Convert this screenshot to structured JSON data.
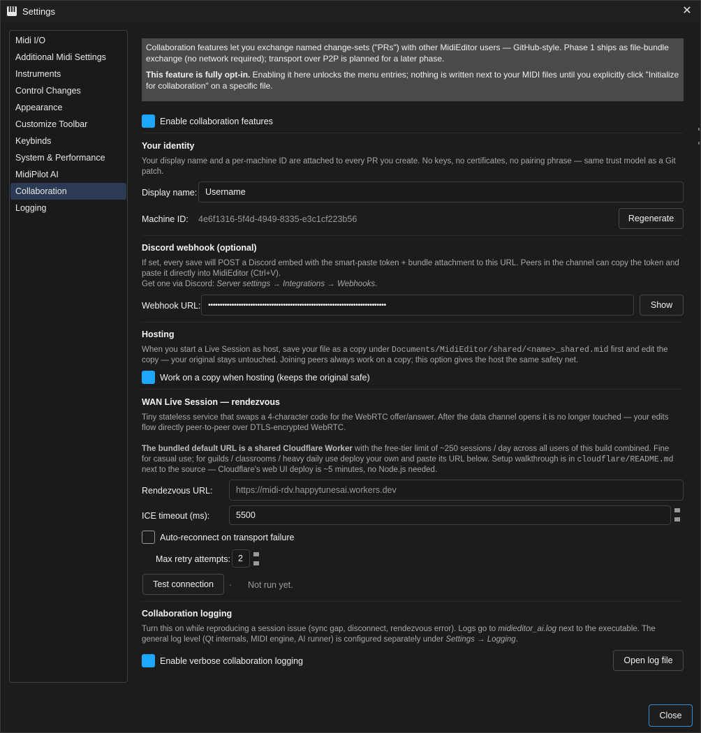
{
  "window": {
    "title": "Settings",
    "close_glyph": "✕"
  },
  "sidebar": {
    "items": [
      {
        "label": "Midi I/O"
      },
      {
        "label": "Additional Midi Settings"
      },
      {
        "label": "Instruments"
      },
      {
        "label": "Control Changes"
      },
      {
        "label": "Appearance"
      },
      {
        "label": "Customize Toolbar"
      },
      {
        "label": "Keybinds"
      },
      {
        "label": "System & Performance"
      },
      {
        "label": "MidiPilot AI"
      },
      {
        "label": "Collaboration",
        "active": true
      },
      {
        "label": "Logging"
      }
    ]
  },
  "info": {
    "p1": "Collaboration features let you exchange named change-sets (\"PRs\") with other MidiEditor users — GitHub-style. Phase 1 ships as file-bundle exchange (no network required); transport over P2P is planned for a later phase.",
    "p2_bold": "This feature is fully opt-in.",
    "p2_rest": " Enabling it here unlocks the menu entries; nothing is written next to your MIDI files until you explicitly click \"Initialize for collaboration\" on a specific file."
  },
  "enable_collab": {
    "label": "Enable collaboration features",
    "checked": true
  },
  "identity": {
    "heading": "Your identity",
    "desc": "Your display name and a per-machine ID are attached to every PR you create. No keys, no certificates, no pairing phrase — same trust model as a Git patch.",
    "display_name_label": "Display name:",
    "display_name_value": "Username",
    "machine_id_label": "Machine ID:",
    "machine_id_value": "4e6f1316-5f4d-4949-8335-e3c1cf223b56",
    "regenerate_label": "Regenerate"
  },
  "discord": {
    "heading": "Discord webhook (optional)",
    "desc1": "If set, every save will POST a Discord embed with the smart-paste token + bundle attachment to this URL. Peers in the channel can copy the token and paste it directly into MidiEditor (Ctrl+V).",
    "desc2_prefix": "Get one via Discord: ",
    "desc2_path": "Server settings → Integrations → Webhooks",
    "desc2_suffix": ".",
    "webhook_label": "Webhook URL:",
    "webhook_value": "••••••••••••••••••••••••••••••••••••••••••••••••••••••••••••••••••••••••••••",
    "show_label": "Show"
  },
  "hosting": {
    "heading": "Hosting",
    "desc_a": "When you start a Live Session as host, save your file as a copy under ",
    "desc_path": "Documents/MidiEditor/shared/<name>_shared.mid",
    "desc_b": " first and edit the copy — your original stays untouched. Joining peers always work on a copy; this option gives the host the same safety net.",
    "work_copy": {
      "label": "Work on a copy when hosting (keeps the original safe)",
      "checked": true
    }
  },
  "wan": {
    "heading": "WAN Live Session — rendezvous",
    "desc1": "Tiny stateless service that swaps a 4-character code for the WebRTC offer/answer. After the data channel opens it is no longer touched — your edits flow directly peer-to-peer over DTLS-encrypted WebRTC.",
    "desc2_bold": "The bundled default URL is a shared Cloudflare Worker",
    "desc2_a": " with the free-tier limit of ~250 sessions / day across all users of this build combined. Fine for casual use; for guilds / classrooms / heavy daily use deploy your own and paste its URL below. Setup walkthrough is in ",
    "desc2_path": "cloudflare/README.md",
    "desc2_b": " next to the source — Cloudflare's web UI deploy is ~5 minutes, no Node.js needed.",
    "rendezvous_label": "Rendezvous URL:",
    "rendezvous_placeholder": "https://midi-rdv.happytunesai.workers.dev",
    "ice_label": "ICE timeout (ms):",
    "ice_value": "5500",
    "auto_reconnect": {
      "label": "Auto-reconnect on transport failure",
      "checked": false
    },
    "max_retry_label": "Max retry attempts:",
    "max_retry_value": "2",
    "test_label": "Test connection",
    "test_dot": "·",
    "test_status": "Not run yet."
  },
  "logging": {
    "heading": "Collaboration logging",
    "desc_a": "Turn this on while reproducing a session issue (sync gap, disconnect, rendezvous error). Logs go to ",
    "desc_file": "midieditor_ai.log",
    "desc_b": " next to the executable. The general log level (Qt internals, MIDI engine, AI runner) is configured separately under ",
    "desc_path": "Settings → Logging",
    "desc_c": ".",
    "verbose": {
      "label": "Enable verbose collaboration logging",
      "checked": true
    },
    "open_log_label": "Open log file"
  },
  "footer": {
    "close_label": "Close"
  },
  "colors": {
    "accent": "#1ea7ff",
    "active_nav": "#2b3a55",
    "info_bg": "#4a4a4a"
  }
}
